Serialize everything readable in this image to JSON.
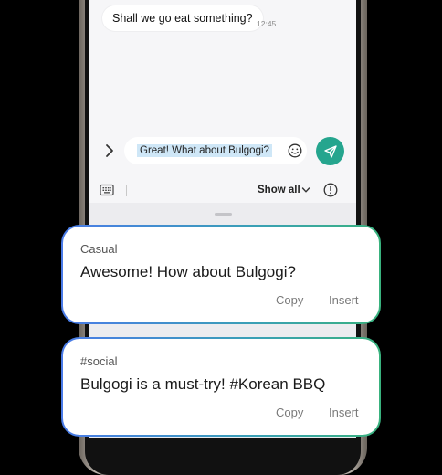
{
  "chat": {
    "message": "Shall we go eat something?",
    "time": "12:45"
  },
  "composer": {
    "input_text": "Great! What about Bulgogi?",
    "accent_color": "#25a58e",
    "icons": [
      "chevron-right-icon",
      "emoji-icon",
      "send-icon"
    ]
  },
  "toolbar": {
    "show_all_label": "Show all",
    "icons": [
      "keyboard-icon",
      "chevron-down-icon",
      "info-icon"
    ]
  },
  "suggestions": [
    {
      "tag": "Casual",
      "text": "Awesome! How about Bulgogi?",
      "copy_label": "Copy",
      "insert_label": "Insert"
    },
    {
      "tag": "#social",
      "text": "Bulgogi is a must-try! #Korean BBQ",
      "copy_label": "Copy",
      "insert_label": "Insert"
    }
  ]
}
